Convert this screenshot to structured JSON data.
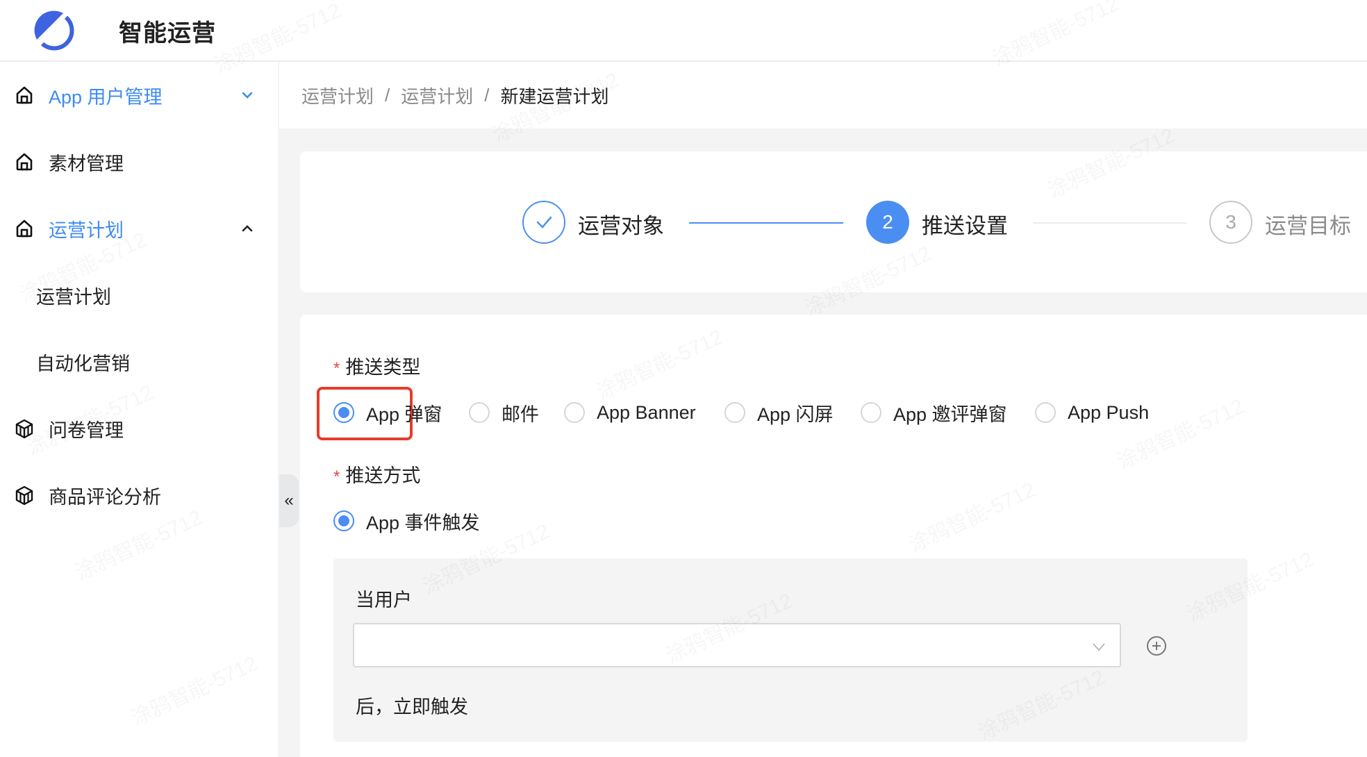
{
  "app": {
    "title": "智能运营",
    "brand_color": "#3e63e0",
    "accent_color": "#4a8ef2"
  },
  "sidebar": {
    "items": [
      {
        "label": "App 用户管理",
        "icon": "home-icon",
        "active": true,
        "expanded": false
      },
      {
        "label": "素材管理",
        "icon": "home-icon",
        "active": false
      },
      {
        "label": "运营计划",
        "icon": "home-icon",
        "active": true,
        "expanded": true,
        "children": [
          {
            "label": "运营计划"
          },
          {
            "label": "自动化营销"
          }
        ]
      },
      {
        "label": "问卷管理",
        "icon": "cube-icon",
        "active": false
      },
      {
        "label": "商品评论分析",
        "icon": "cube-icon",
        "active": false
      }
    ],
    "collapse_glyph": "«"
  },
  "breadcrumb": {
    "items": [
      "运营计划",
      "运营计划"
    ],
    "separator": "/",
    "current": "新建运营计划"
  },
  "steps": [
    {
      "label": "运营对象",
      "status": "done",
      "marker": "✓"
    },
    {
      "label": "推送设置",
      "status": "active",
      "marker": "2"
    },
    {
      "label": "运营目标",
      "status": "pending",
      "marker": "3"
    }
  ],
  "form": {
    "push_type": {
      "label": "推送类型",
      "required_mark": "*",
      "options": [
        "App 弹窗",
        "邮件",
        "App Banner",
        "App 闪屏",
        "App 邀评弹窗",
        "App Push"
      ],
      "selected": "App 弹窗"
    },
    "push_method": {
      "label": "推送方式",
      "required_mark": "*",
      "options": [
        "App 事件触发"
      ],
      "selected": "App 事件触发"
    },
    "trigger": {
      "when_label": "当用户",
      "event_select_value": "",
      "after_label": "后，立即触发"
    }
  },
  "watermark": "涂鸦智能-5712"
}
